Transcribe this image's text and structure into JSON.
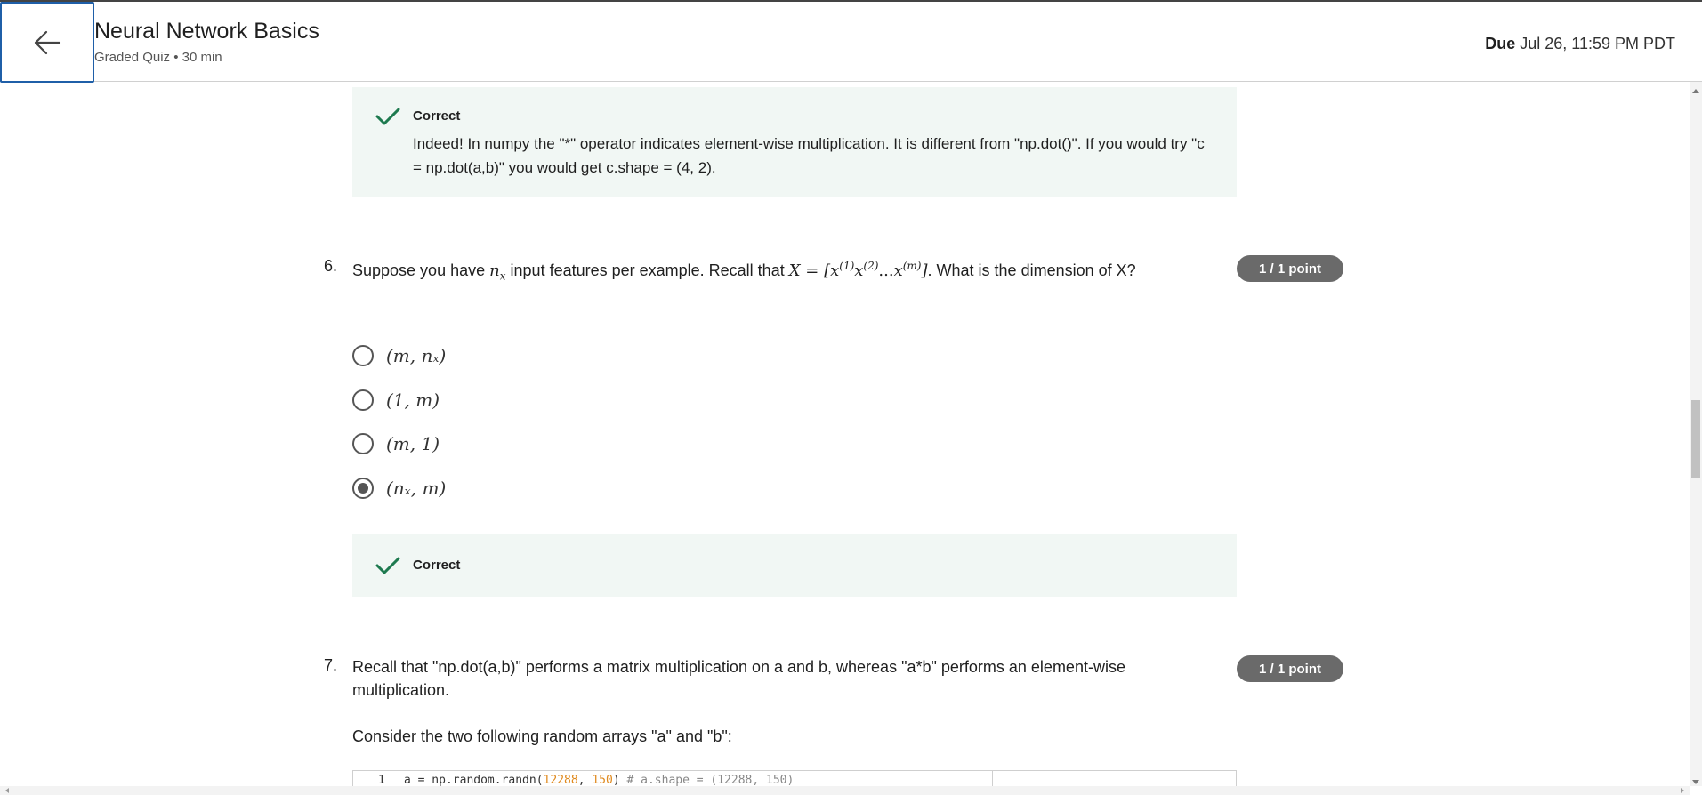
{
  "header": {
    "title": "Neural Network Basics",
    "subtitle": "Graded Quiz • 30 min",
    "due_label": "Due",
    "due_value": "Jul 26, 11:59 PM PDT"
  },
  "feedback_q5": {
    "label": "Correct",
    "text": "Indeed! In numpy the \"*\" operator indicates element-wise multiplication. It is different from \"np.dot()\". If you would try \"c = np.dot(a,b)\" you would get c.shape = (4, 2)."
  },
  "q6": {
    "number": "6.",
    "text_a": "Suppose you have",
    "text_b": "input features per example. Recall that",
    "text_c": ". What is the dimension of X?",
    "points": "1 / 1 point",
    "options": [
      {
        "label": "(m, nₓ)",
        "selected": false
      },
      {
        "label": "(1, m)",
        "selected": false
      },
      {
        "label": "(m, 1)",
        "selected": false
      },
      {
        "label": "(nₓ, m)",
        "selected": true
      }
    ],
    "feedback_label": "Correct"
  },
  "q7": {
    "number": "7.",
    "text": "Recall that \"np.dot(a,b)\" performs a matrix multiplication on a and b, whereas \"a*b\" performs an element-wise multiplication.",
    "text2": "Consider the two following random arrays \"a\" and \"b\":",
    "points": "1 / 1 point",
    "code_line_number": "1",
    "code_prefix": "a = np.random.randn(",
    "code_num1": "12288",
    "code_sep": ", ",
    "code_num2": "150",
    "code_close": ") ",
    "code_comment": "# a.shape = (12288, 150)"
  }
}
